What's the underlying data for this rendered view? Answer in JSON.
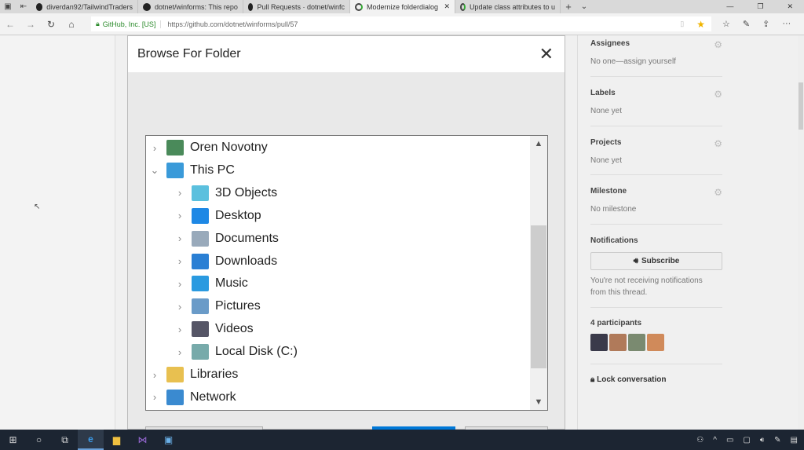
{
  "browser": {
    "tabs": [
      {
        "label": "diverdan92/TailwindTraders",
        "icon": "github-icon"
      },
      {
        "label": "dotnet/winforms: This repo",
        "icon": "github-icon"
      },
      {
        "label": "Pull Requests · dotnet/winfc",
        "icon": "github-icon"
      },
      {
        "label": "Modernize folderdialog",
        "icon": "loading-icon",
        "active": true
      },
      {
        "label": "Update class attributes to u",
        "icon": "loading-icon"
      }
    ],
    "tab_close": "✕",
    "new_tab": "+",
    "tab_menu": "⌄",
    "window_controls": {
      "minimize": "—",
      "restore": "❐",
      "close": "✕"
    },
    "cert_org": "GitHub, Inc. [US]",
    "url": "https://github.com/dotnet/winforms/pull/57",
    "more": "···"
  },
  "dialog": {
    "title": "Browse For Folder",
    "close": "✕",
    "tree": [
      {
        "label": "Oren Novotny",
        "level": 0,
        "expanded": false,
        "icon": "user-icon",
        "color": "#4a8a5a"
      },
      {
        "label": "This PC",
        "level": 0,
        "expanded": true,
        "icon": "computer-icon",
        "color": "#3a9ad9"
      },
      {
        "label": "3D Objects",
        "level": 1,
        "expanded": false,
        "icon": "3d-objects-icon",
        "color": "#5bc0de"
      },
      {
        "label": "Desktop",
        "level": 1,
        "expanded": false,
        "icon": "desktop-icon",
        "color": "#1e88e5"
      },
      {
        "label": "Documents",
        "level": 1,
        "expanded": false,
        "icon": "documents-icon",
        "color": "#9ab"
      },
      {
        "label": "Downloads",
        "level": 1,
        "expanded": false,
        "icon": "downloads-icon",
        "color": "#2a7fd4"
      },
      {
        "label": "Music",
        "level": 1,
        "expanded": false,
        "icon": "music-icon",
        "color": "#2a9ae0"
      },
      {
        "label": "Pictures",
        "level": 1,
        "expanded": false,
        "icon": "pictures-icon",
        "color": "#6a9bc8"
      },
      {
        "label": "Videos",
        "level": 1,
        "expanded": false,
        "icon": "videos-icon",
        "color": "#556"
      },
      {
        "label": "Local Disk (C:)",
        "level": 1,
        "expanded": false,
        "icon": "local-disk-icon",
        "color": "#7aa"
      },
      {
        "label": "Libraries",
        "level": 0,
        "expanded": false,
        "icon": "libraries-icon",
        "color": "#e8c050"
      },
      {
        "label": "Network",
        "level": 0,
        "expanded": false,
        "icon": "network-icon",
        "color": "#3a8ad0"
      }
    ]
  },
  "sidebar": {
    "assignees": {
      "title": "Assignees",
      "value": "No one—assign yourself"
    },
    "labels": {
      "title": "Labels",
      "value": "None yet"
    },
    "projects": {
      "title": "Projects",
      "value": "None yet"
    },
    "milestone": {
      "title": "Milestone",
      "value": "No milestone"
    },
    "notifications": {
      "title": "Notifications",
      "button": "Subscribe",
      "note": "You're not receiving notifications from this thread."
    },
    "participants": {
      "title": "4 participants",
      "avatar_colors": [
        "#3a3a4a",
        "#b07a5a",
        "#7a8a70",
        "#d08a5a"
      ]
    },
    "lock": "Lock conversation"
  }
}
